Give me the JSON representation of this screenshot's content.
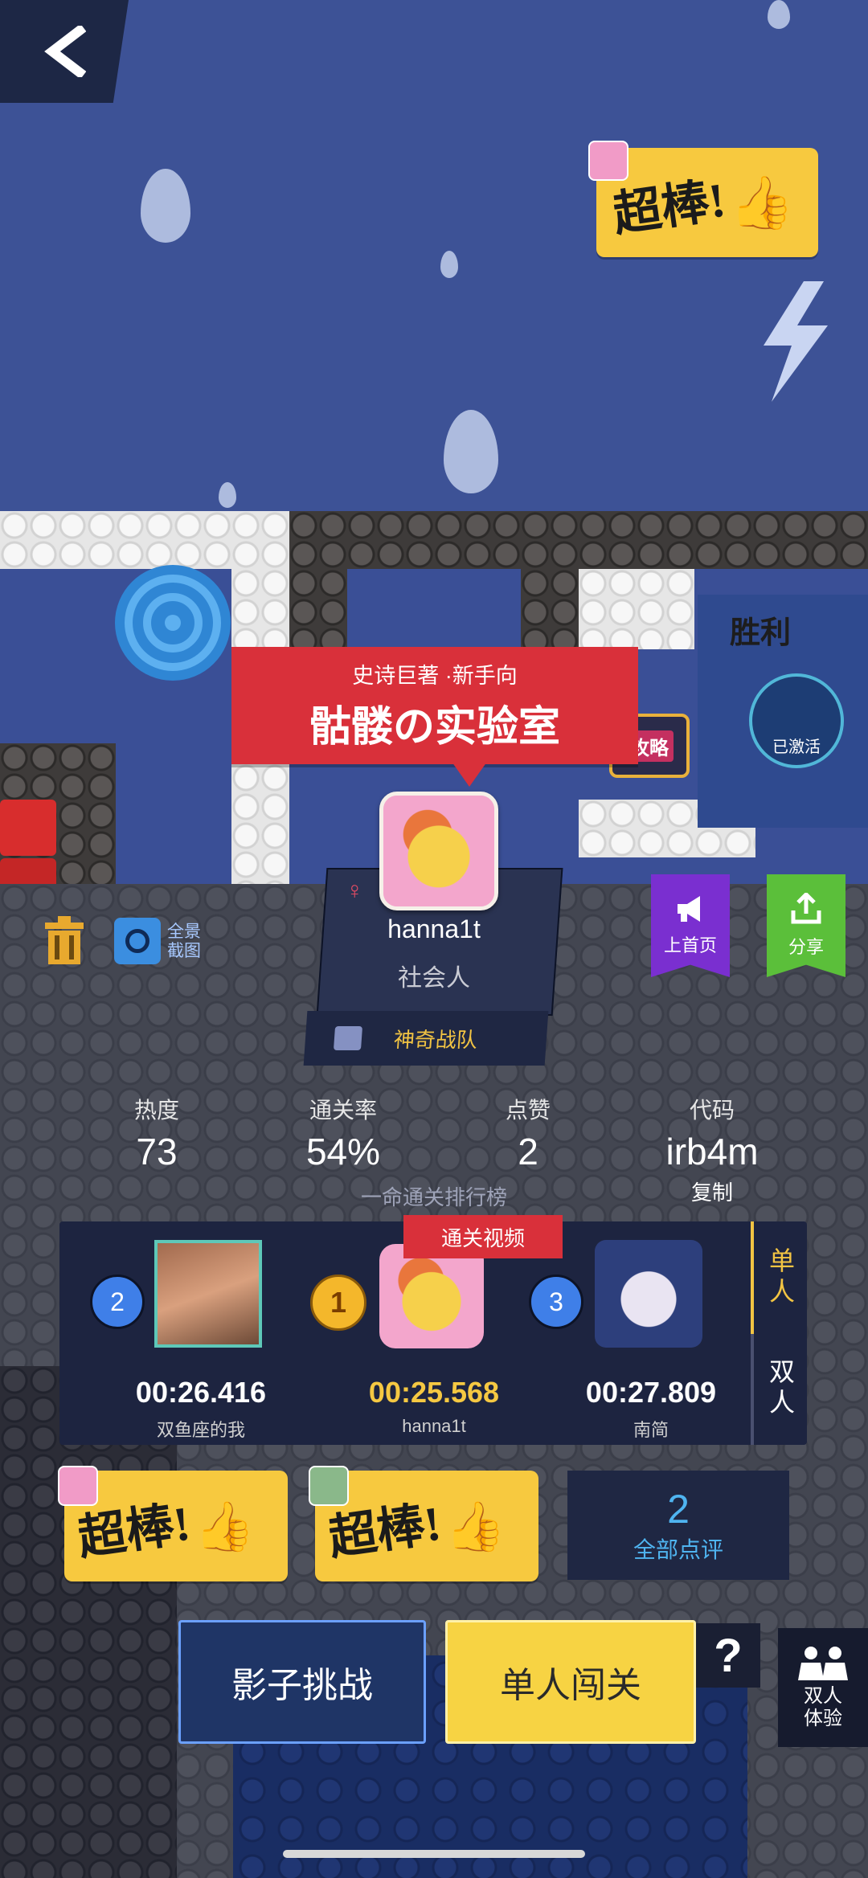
{
  "level": {
    "subtitle": "史诗巨著 ·新手向",
    "title": "骷髅の实验室"
  },
  "author": {
    "gender_icon": "♀",
    "name": "hanna1t",
    "rank": "社会人",
    "team": "神奇战队"
  },
  "toolbar": {
    "panorama_label": "全景\n截图",
    "feature_label": "上首页",
    "share_label": "分享"
  },
  "stats": [
    {
      "label": "热度",
      "value": "73"
    },
    {
      "label": "通关率",
      "value": "54%"
    },
    {
      "label": "点赞",
      "value": "2"
    },
    {
      "label": "代码",
      "value": "irb4m"
    }
  ],
  "code_copy_label": "复制",
  "leaderboard": {
    "title": "一命通关排行榜",
    "video_label": "通关视频",
    "tabs": [
      "单人",
      "双人"
    ],
    "entries": [
      {
        "rank": "2",
        "time": "00:26.416",
        "name": "双鱼座的我"
      },
      {
        "rank": "1",
        "time": "00:25.568",
        "name": "hanna1t"
      },
      {
        "rank": "3",
        "time": "00:27.809",
        "name": "南简"
      }
    ]
  },
  "stickers": {
    "text": "超棒!"
  },
  "reviews": {
    "count": "2",
    "label": "全部点评"
  },
  "actions": {
    "shadow_challenge": "影子挑战",
    "solo_play": "单人闯关",
    "help": "?",
    "duo_try": "双人\n体验"
  },
  "scene": {
    "sign_text": "胜利",
    "guide_label": "攻略",
    "activated_label": "已激活"
  },
  "colors": {
    "banner_red": "#d9303a",
    "sticker_yellow": "#f7c93f",
    "feature_purple": "#7a2fd0",
    "share_green": "#5bbf3a",
    "time_gold": "#f5c842"
  }
}
